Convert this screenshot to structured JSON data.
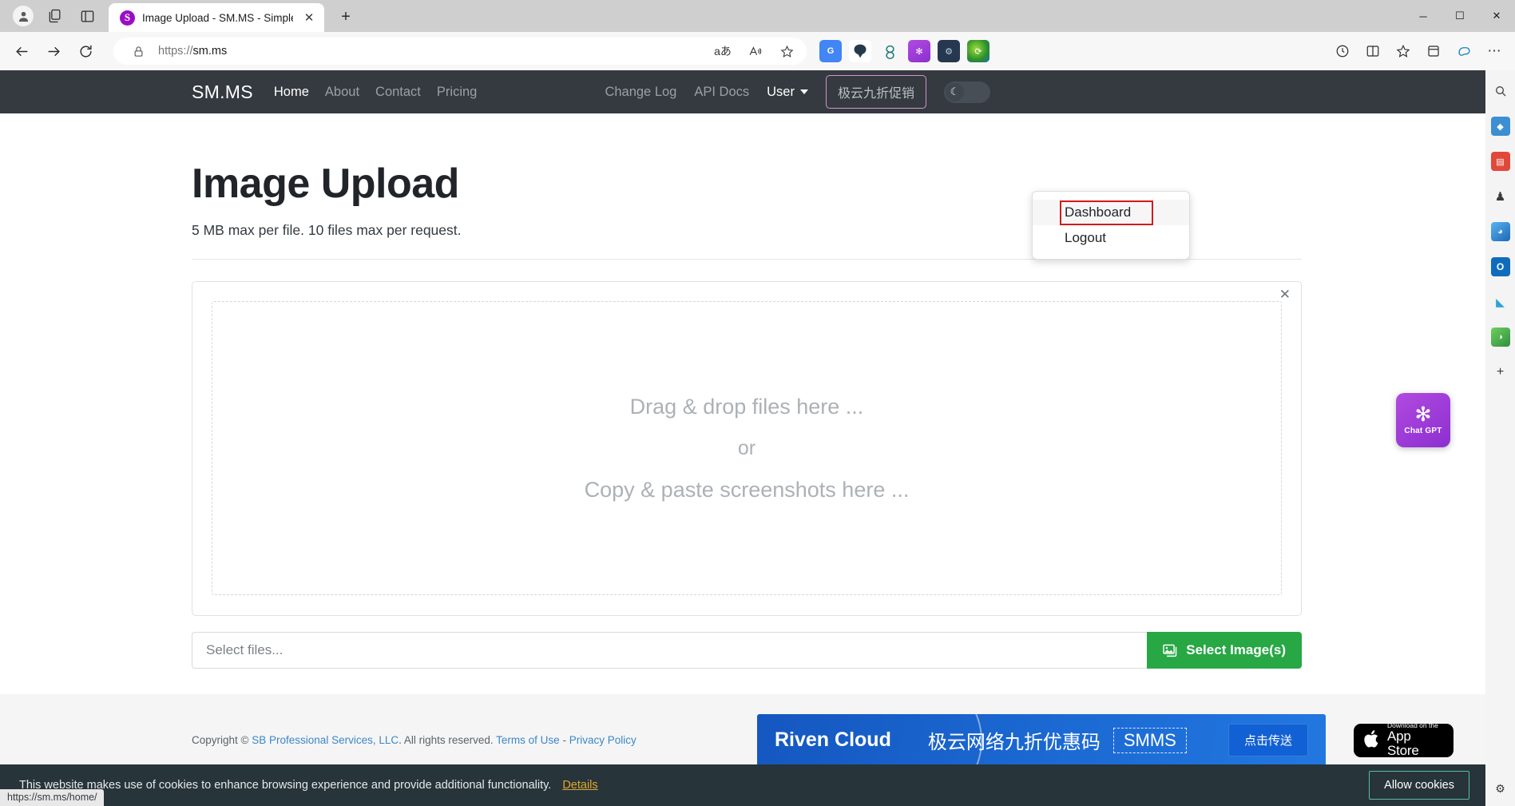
{
  "browser": {
    "tab": {
      "title": "Image Upload - SM.MS - Simple",
      "favicon_letter": "S",
      "close_label": "✕"
    },
    "new_tab_label": "+",
    "window_controls": {
      "minimize": "─",
      "maximize": "☐",
      "close": "✕"
    },
    "nav": {
      "back": "←",
      "forward": "→",
      "reload": "⟳"
    },
    "address": {
      "scheme": "https://",
      "host": "sm.ms",
      "lock_icon": "lock-icon"
    },
    "omnibox_icons": [
      {
        "name": "translate-icon",
        "glyph": "aあ"
      },
      {
        "name": "read-aloud-icon",
        "glyph": "A͓"
      },
      {
        "name": "favorite-star-icon",
        "glyph": "☆"
      }
    ],
    "extensions": [
      {
        "name": "google-translate-extension",
        "glyph": "G"
      },
      {
        "name": "sider-extension",
        "glyph": "⌬"
      },
      {
        "name": "openai-extension",
        "glyph": "✽"
      },
      {
        "name": "chatgpt-extension",
        "glyph": "✻"
      },
      {
        "name": "game-extension",
        "glyph": "⚙"
      },
      {
        "name": "idm-extension",
        "glyph": "⟳"
      }
    ],
    "toolbar_right": [
      {
        "name": "browser-essentials-icon",
        "glyph": "◎"
      },
      {
        "name": "split-screen-icon",
        "glyph": "◫"
      },
      {
        "name": "favorites-icon",
        "glyph": "☆"
      },
      {
        "name": "collections-icon",
        "glyph": "⊞"
      },
      {
        "name": "copilot-icon",
        "glyph": "◔"
      },
      {
        "name": "settings-more-icon",
        "glyph": "⋯"
      }
    ],
    "status_bubble": "https://sm.ms/home/"
  },
  "site_nav": {
    "brand": "SM.MS",
    "left_links": [
      {
        "label": "Home",
        "active": true
      },
      {
        "label": "About",
        "active": false
      },
      {
        "label": "Contact",
        "active": false
      },
      {
        "label": "Pricing",
        "active": false
      }
    ],
    "right_links": [
      {
        "label": "Change Log"
      },
      {
        "label": "API Docs"
      }
    ],
    "user_label": "User",
    "promo_label": "极云九折促销",
    "dark_toggle_icon": "☾",
    "promo_border_color": "#d892c9"
  },
  "user_menu": {
    "items": [
      {
        "label": "Dashboard",
        "highlighted": true
      },
      {
        "label": "Logout",
        "highlighted": false
      }
    ],
    "highlight_color": "#d21b1b"
  },
  "main": {
    "title": "Image Upload",
    "subtitle": "5 MB max per file. 10 files max per request.",
    "card_close": "✕",
    "dropzone": {
      "line1": "Drag & drop files here ...",
      "or": "or",
      "line2": "Copy & paste screenshots here ..."
    },
    "file_input_placeholder": "Select files...",
    "file_input_value": "",
    "select_button": "Select Image(s)",
    "select_button_color": "#28a745"
  },
  "footer": {
    "copyright_prefix": "Copyright",
    "copyright_symbol": "©",
    "company": "SB Professional Services, LLC",
    "rights": ". All rights reserved. ",
    "terms": "Terms of Use",
    "separator": " - ",
    "privacy": "Privacy Policy",
    "ad": {
      "brand": "Riven Cloud",
      "text": "极云网络九折优惠码",
      "code": "SMMS",
      "cta": "点击传送"
    },
    "appstore": {
      "small": "Download on the",
      "big": "App Store",
      "apple_glyph": ""
    }
  },
  "cookie_bar": {
    "text": "This website makes use of cookies to enhance browsing experience and provide additional functionality.",
    "details": "Details",
    "allow_button": "Allow cookies",
    "allow_border_color": "#5bbfa5"
  },
  "side_rail": {
    "icons": [
      {
        "name": "search-icon",
        "glyph": "⌕"
      },
      {
        "name": "copilot-sidebar-icon",
        "glyph": "◆"
      },
      {
        "name": "shopping-icon",
        "glyph": "Ὤd"
      },
      {
        "name": "tools-icon",
        "glyph": "♟"
      },
      {
        "name": "games-icon",
        "glyph": "◕"
      },
      {
        "name": "outlook-icon",
        "glyph": "O"
      },
      {
        "name": "drop-icon",
        "glyph": "◢"
      },
      {
        "name": "browser-essentials-rail-icon",
        "glyph": "◑"
      },
      {
        "name": "add-sidebar-icon",
        "glyph": "+"
      }
    ],
    "settings_icon": "⚙"
  },
  "chatgpt_widget": {
    "glyph": "✻",
    "label": "Chat GPT"
  }
}
